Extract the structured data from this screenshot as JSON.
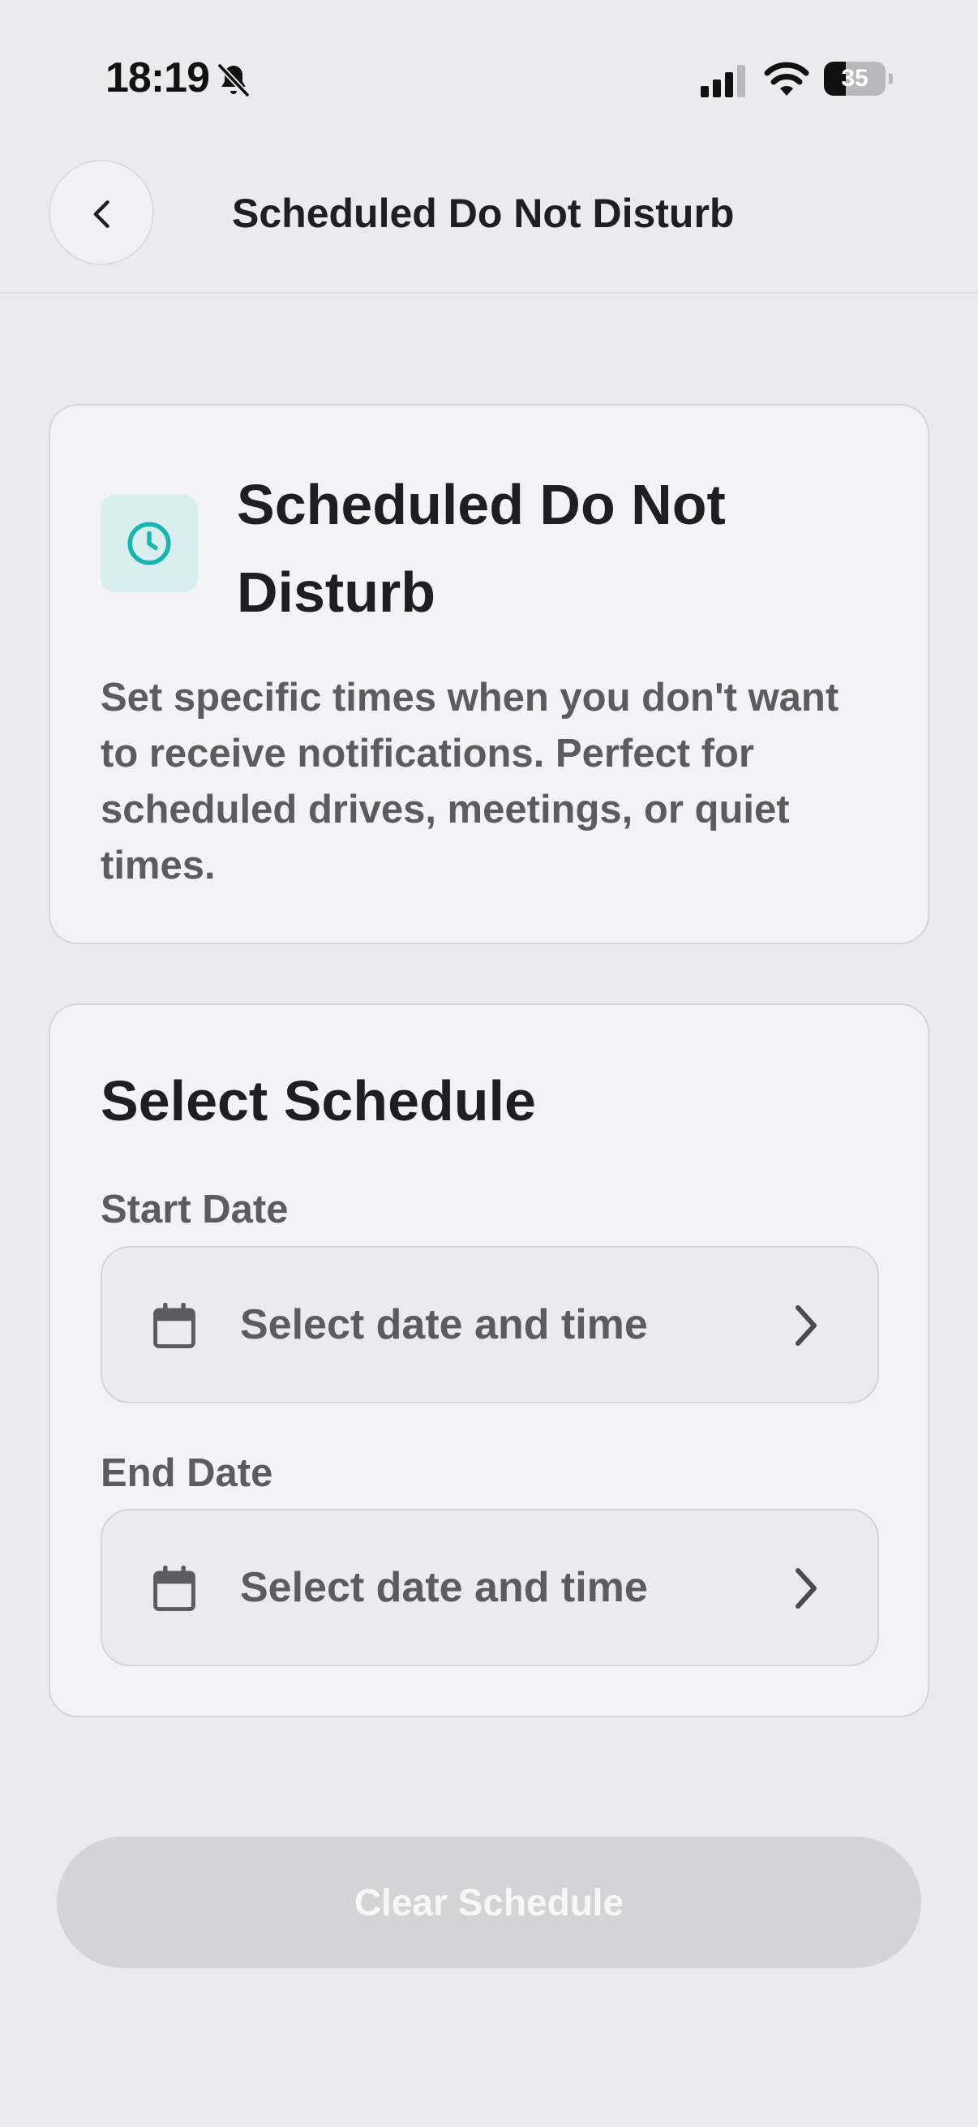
{
  "status_bar": {
    "time": "18:19",
    "battery_level": "35",
    "battery_fraction": 0.35,
    "icons": [
      "bell-slash-icon",
      "cellular-signal-icon",
      "wifi-icon",
      "battery-icon"
    ]
  },
  "header": {
    "title": "Scheduled Do Not Disturb",
    "back_icon": "chevron-left-icon"
  },
  "info_card": {
    "icon": "clock-icon",
    "title": "Scheduled Do Not Disturb",
    "description": "Set specific times when you don't want to receive notifications. Perfect for scheduled drives, meetings, or quiet times."
  },
  "schedule_card": {
    "title": "Select Schedule",
    "start": {
      "label": "Start Date",
      "placeholder": "Select date and time"
    },
    "end": {
      "label": "End Date",
      "placeholder": "Select date and time"
    }
  },
  "footer": {
    "clear_label": "Clear Schedule"
  },
  "colors": {
    "background": "#ebebed",
    "card": "#f3f3f5",
    "accent_teal": "#1ab5b0",
    "disabled_button": "#d4d4d6"
  }
}
